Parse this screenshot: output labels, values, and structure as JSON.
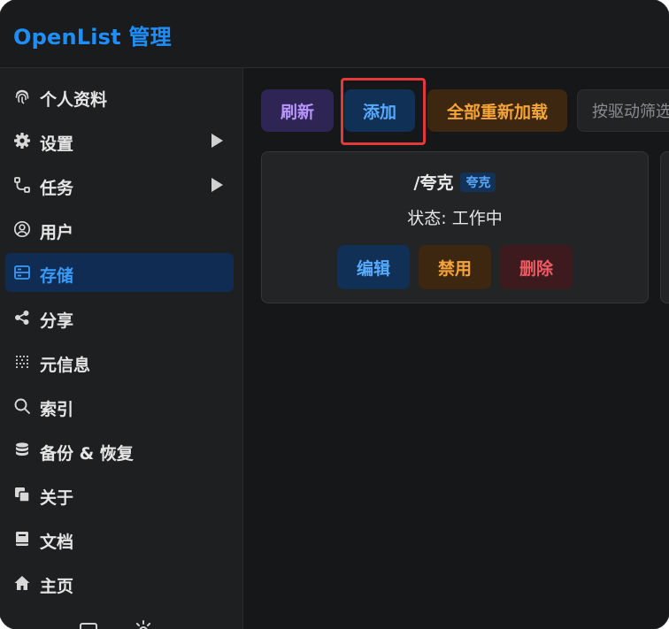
{
  "header": {
    "title": "OpenList 管理"
  },
  "sidebar": {
    "items": [
      {
        "label": "个人资料",
        "icon": "fingerprint-icon"
      },
      {
        "label": "设置",
        "icon": "gear-icon",
        "expandable": true
      },
      {
        "label": "任务",
        "icon": "flow-icon",
        "expandable": true
      },
      {
        "label": "用户",
        "icon": "user-circle-icon"
      },
      {
        "label": "存储",
        "icon": "storage-icon",
        "active": true
      },
      {
        "label": "分享",
        "icon": "share-icon"
      },
      {
        "label": "元信息",
        "icon": "meta-icon"
      },
      {
        "label": "索引",
        "icon": "search-icon"
      },
      {
        "label": "备份 & 恢复",
        "icon": "database-icon"
      },
      {
        "label": "关于",
        "icon": "copy-icon"
      },
      {
        "label": "文档",
        "icon": "book-icon"
      },
      {
        "label": "主页",
        "icon": "home-icon"
      }
    ]
  },
  "toolbar": {
    "refresh_label": "刷新",
    "add_label": "添加",
    "reload_all_label": "全部重新加载",
    "filter_placeholder": "按驱动筛选"
  },
  "storage_card": {
    "mount_path": "/夸克",
    "driver_tag": "夸克",
    "status": "状态: 工作中",
    "edit_label": "编辑",
    "disable_label": "禁用",
    "delete_label": "删除"
  },
  "colors": {
    "brand": "#1e8ffa",
    "active_bg": "#102c52",
    "highlight": "#e23a3a"
  }
}
